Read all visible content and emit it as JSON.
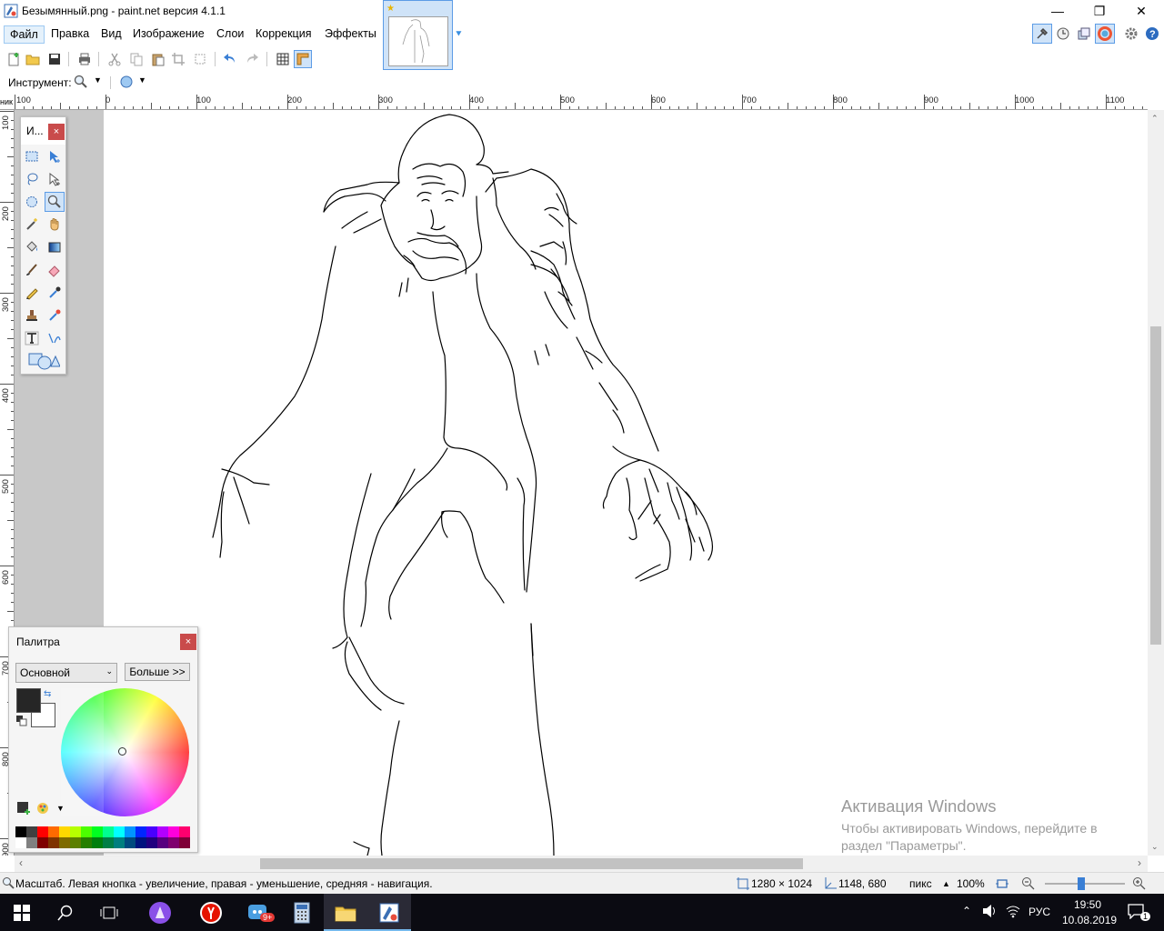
{
  "window": {
    "title": "Безымянный.png - paint.net версия 4.1.1",
    "minimize": "—",
    "restore": "❐",
    "close": "✕"
  },
  "menu": {
    "items": [
      "Файл",
      "Правка",
      "Вид",
      "Изображение",
      "Слои",
      "Коррекция",
      "Эффекты"
    ]
  },
  "toolbar": {
    "tool_label": "Инструмент:"
  },
  "rulers": {
    "unit": "ник",
    "h_labels": [
      "100",
      "0",
      "100",
      "200",
      "300",
      "400",
      "500",
      "600",
      "700",
      "800",
      "900",
      "1000",
      "1100"
    ],
    "v_labels": [
      "100",
      "200",
      "300",
      "400",
      "500",
      "600",
      "700",
      "800",
      "900"
    ]
  },
  "tools_window": {
    "title": "И...",
    "close": "×"
  },
  "palette_window": {
    "title": "Палитра",
    "close": "×",
    "palette_name": "Основной",
    "more_button": "Больше >>",
    "primary_color": "#262626",
    "secondary_color": "#ffffff",
    "swatches_row1": [
      "#000000",
      "#404040",
      "#ff0000",
      "#ff6a00",
      "#ffd800",
      "#b6ff00",
      "#4cff00",
      "#00ff21",
      "#00ff90",
      "#00ffff",
      "#0094ff",
      "#0026ff",
      "#4800ff",
      "#b200ff",
      "#ff00dc",
      "#ff006e"
    ],
    "swatches_row2": [
      "#ffffff",
      "#808080",
      "#7f0000",
      "#7f3300",
      "#7f6a00",
      "#5b7f00",
      "#267f00",
      "#007f0e",
      "#007f46",
      "#007f7f",
      "#004a7f",
      "#00137f",
      "#21007f",
      "#57007f",
      "#7f006e",
      "#7f0037"
    ]
  },
  "watermark": {
    "line1": "Активация Windows",
    "line2": "Чтобы активировать Windows, перейдите в",
    "line3": "раздел \"Параметры\"."
  },
  "statusbar": {
    "hint": "Масштаб. Левая кнопка - увеличение, правая - уменьшение, средняя - навигация.",
    "image_size": "1280 × 1024",
    "cursor_pos": "1148, 680",
    "units": "пикс",
    "zoom": "100%",
    "zoom_fraction": 0.45
  },
  "taskbar": {
    "language": "РУС",
    "time": "19:50",
    "date": "10.08.2019",
    "notification_count": "1",
    "badge": "9+"
  },
  "colors": {
    "accent": "#5c9ce6",
    "selection_bg": "#cfe3f8",
    "close_red": "#c94b4b",
    "workspace_gray": "#c8c8c8"
  }
}
